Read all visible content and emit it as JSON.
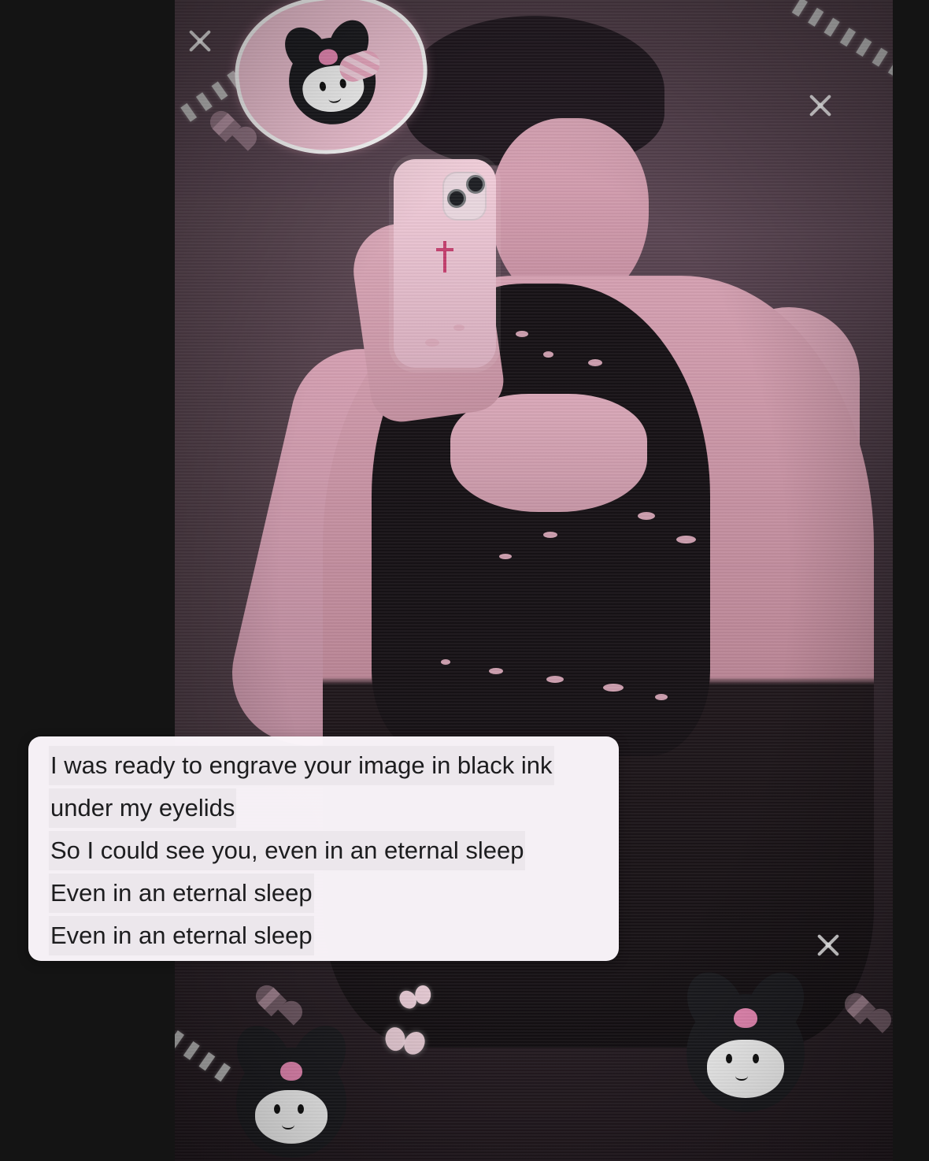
{
  "caption": {
    "lines": [
      "I was ready to engrave your image in black ink",
      "under my eyelids",
      "So I could see you, even in an eternal sleep",
      "Even in an eternal sleep",
      "Even in an eternal sleep"
    ]
  },
  "decor": {
    "stickers": [
      "heart-character-sticker",
      "lower-left-character-sticker",
      "lower-right-character-sticker"
    ],
    "icons": [
      "chain-icon",
      "sparkle-icon",
      "heart-icon",
      "butterfly-icon"
    ]
  }
}
